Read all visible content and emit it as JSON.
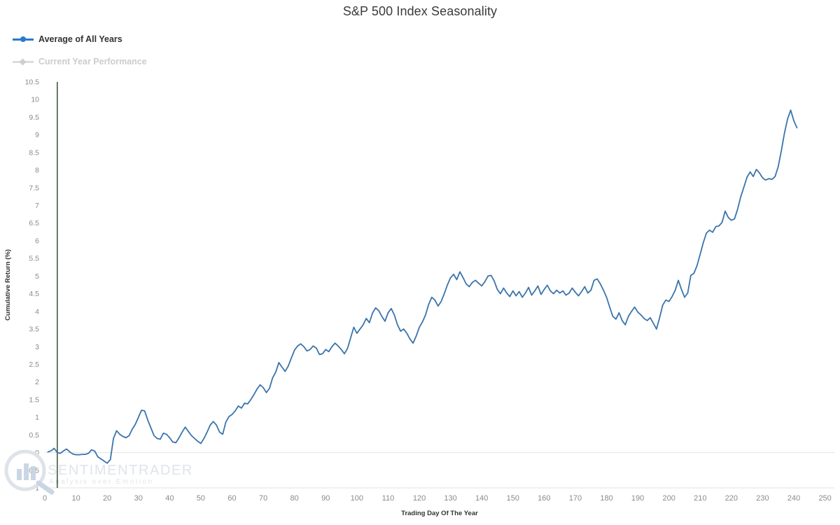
{
  "header": {
    "title": "S&P 500 Index Seasonality"
  },
  "legend": {
    "position": "top-left",
    "items": [
      {
        "label": "Average of All Years",
        "color": "#2b7ac9",
        "marker": "circle",
        "state": "active"
      },
      {
        "label": "Current Year Performance",
        "color": "#d0d0d0",
        "marker": "diamond",
        "state": "inactive"
      }
    ]
  },
  "watermark": {
    "main": "SENTIMENTRADER",
    "sub": "Analysis over Emotion",
    "icon": "magnifier-bars-logo"
  },
  "annotations": {
    "today_marker": {
      "label": "current-trading-day-line",
      "x": 4,
      "color": "#1d4a1d"
    }
  },
  "chart_data": {
    "type": "line",
    "title": "S&P 500 Index Seasonality",
    "xlabel": "Trading Day Of The Year",
    "ylabel": "Cumulative Return (%)",
    "xlim": [
      0,
      253
    ],
    "ylim": [
      -1,
      10.5
    ],
    "grid": false,
    "zero_line": true,
    "xticks": [
      0,
      10,
      20,
      30,
      40,
      50,
      60,
      70,
      80,
      90,
      100,
      110,
      120,
      130,
      140,
      150,
      160,
      170,
      180,
      190,
      200,
      210,
      220,
      230,
      240,
      250
    ],
    "yticks": [
      -1,
      -0.5,
      0,
      0.5,
      1,
      1.5,
      2,
      2.5,
      3,
      3.5,
      4,
      4.5,
      5,
      5.5,
      6,
      6.5,
      7,
      7.5,
      8,
      8.5,
      9,
      9.5,
      10,
      10.5
    ],
    "ytick_labels": [
      "-1",
      "-0.5",
      "0",
      "0.5",
      "1",
      "1.5",
      "2",
      "2.5",
      "3",
      "3.5",
      "4",
      "4.5",
      "5",
      "5.5",
      "6",
      "6.5",
      "7",
      "7.5",
      "8",
      "8.5",
      "9",
      "9.5",
      "10",
      "10.5"
    ],
    "series": [
      {
        "name": "Average of All Years",
        "color": "#3a74ab",
        "x": [
          1,
          2,
          3,
          4,
          5,
          6,
          7,
          8,
          9,
          10,
          11,
          12,
          13,
          14,
          15,
          16,
          17,
          18,
          19,
          20,
          21,
          22,
          23,
          24,
          25,
          26,
          27,
          28,
          29,
          30,
          31,
          32,
          33,
          34,
          35,
          36,
          37,
          38,
          39,
          40,
          41,
          42,
          43,
          44,
          45,
          46,
          47,
          48,
          49,
          50,
          51,
          52,
          53,
          54,
          55,
          56,
          57,
          58,
          59,
          60,
          61,
          62,
          63,
          64,
          65,
          66,
          67,
          68,
          69,
          70,
          71,
          72,
          73,
          74,
          75,
          76,
          77,
          78,
          79,
          80,
          81,
          82,
          83,
          84,
          85,
          86,
          87,
          88,
          89,
          90,
          91,
          92,
          93,
          94,
          95,
          96,
          97,
          98,
          99,
          100,
          101,
          102,
          103,
          104,
          105,
          106,
          107,
          108,
          109,
          110,
          111,
          112,
          113,
          114,
          115,
          116,
          117,
          118,
          119,
          120,
          121,
          122,
          123,
          124,
          125,
          126,
          127,
          128,
          129,
          130,
          131,
          132,
          133,
          134,
          135,
          136,
          137,
          138,
          139,
          140,
          141,
          142,
          143,
          144,
          145,
          146,
          147,
          148,
          149,
          150,
          151,
          152,
          153,
          154,
          155,
          156,
          157,
          158,
          159,
          160,
          161,
          162,
          163,
          164,
          165,
          166,
          167,
          168,
          169,
          170,
          171,
          172,
          173,
          174,
          175,
          176,
          177,
          178,
          179,
          180,
          181,
          182,
          183,
          184,
          185,
          186,
          187,
          188,
          189,
          190,
          191,
          192,
          193,
          194,
          195,
          196,
          197,
          198,
          199,
          200,
          201,
          202,
          203,
          204,
          205,
          206,
          207,
          208,
          209,
          210,
          211,
          212,
          213,
          214,
          215,
          216,
          217,
          218,
          219,
          220,
          221,
          222,
          223,
          224,
          225,
          226,
          227,
          228,
          229,
          230,
          231,
          232,
          233,
          234,
          235,
          236,
          237,
          238,
          239,
          240,
          241,
          242,
          243,
          244,
          245,
          246,
          247,
          248,
          249,
          250,
          251,
          252
        ],
        "values": [
          0.02,
          0.05,
          0.12,
          0.0,
          -0.02,
          0.05,
          0.1,
          0.02,
          -0.04,
          -0.06,
          -0.06,
          -0.05,
          -0.05,
          -0.02,
          0.08,
          0.04,
          -0.12,
          -0.18,
          -0.24,
          -0.3,
          -0.2,
          0.4,
          0.62,
          0.52,
          0.46,
          0.42,
          0.48,
          0.66,
          0.8,
          1.0,
          1.2,
          1.18,
          0.92,
          0.7,
          0.48,
          0.4,
          0.38,
          0.55,
          0.52,
          0.42,
          0.3,
          0.28,
          0.42,
          0.58,
          0.72,
          0.6,
          0.48,
          0.4,
          0.32,
          0.26,
          0.4,
          0.58,
          0.78,
          0.88,
          0.78,
          0.58,
          0.52,
          0.86,
          1.02,
          1.08,
          1.18,
          1.32,
          1.26,
          1.4,
          1.38,
          1.5,
          1.64,
          1.8,
          1.92,
          1.84,
          1.7,
          1.82,
          2.12,
          2.28,
          2.55,
          2.42,
          2.3,
          2.45,
          2.68,
          2.9,
          3.02,
          3.08,
          3.0,
          2.88,
          2.92,
          3.02,
          2.96,
          2.78,
          2.8,
          2.92,
          2.86,
          3.0,
          3.1,
          3.02,
          2.92,
          2.8,
          2.95,
          3.25,
          3.55,
          3.38,
          3.5,
          3.62,
          3.8,
          3.68,
          3.95,
          4.1,
          4.02,
          3.86,
          3.72,
          3.96,
          4.08,
          3.9,
          3.62,
          3.44,
          3.5,
          3.38,
          3.22,
          3.1,
          3.3,
          3.55,
          3.7,
          3.9,
          4.2,
          4.4,
          4.32,
          4.15,
          4.28,
          4.5,
          4.75,
          4.95,
          5.05,
          4.9,
          5.12,
          4.96,
          4.78,
          4.7,
          4.82,
          4.88,
          4.8,
          4.72,
          4.84,
          5.0,
          5.02,
          4.86,
          4.62,
          4.5,
          4.66,
          4.52,
          4.42,
          4.58,
          4.44,
          4.56,
          4.4,
          4.52,
          4.68,
          4.46,
          4.58,
          4.72,
          4.48,
          4.62,
          4.74,
          4.58,
          4.5,
          4.6,
          4.52,
          4.58,
          4.46,
          4.52,
          4.66,
          4.54,
          4.44,
          4.56,
          4.7,
          4.52,
          4.6,
          4.88,
          4.92,
          4.78,
          4.6,
          4.4,
          4.12,
          3.86,
          3.78,
          3.96,
          3.74,
          3.62,
          3.86,
          4.0,
          4.12,
          3.98,
          3.9,
          3.8,
          3.74,
          3.82,
          3.66,
          3.5,
          3.82,
          4.18,
          4.32,
          4.28,
          4.42,
          4.6,
          4.88,
          4.62,
          4.4,
          4.52,
          5.02,
          5.08,
          5.3,
          5.62,
          5.95,
          6.22,
          6.3,
          6.24,
          6.4,
          6.42,
          6.52,
          6.84,
          6.66,
          6.58,
          6.62,
          6.9,
          7.25,
          7.52,
          7.8,
          7.95,
          7.82,
          8.02,
          7.92,
          7.78,
          7.72,
          7.76,
          7.74,
          7.82,
          8.1,
          8.55,
          9.05,
          9.45,
          9.7,
          9.4,
          9.2
        ]
      }
    ]
  }
}
